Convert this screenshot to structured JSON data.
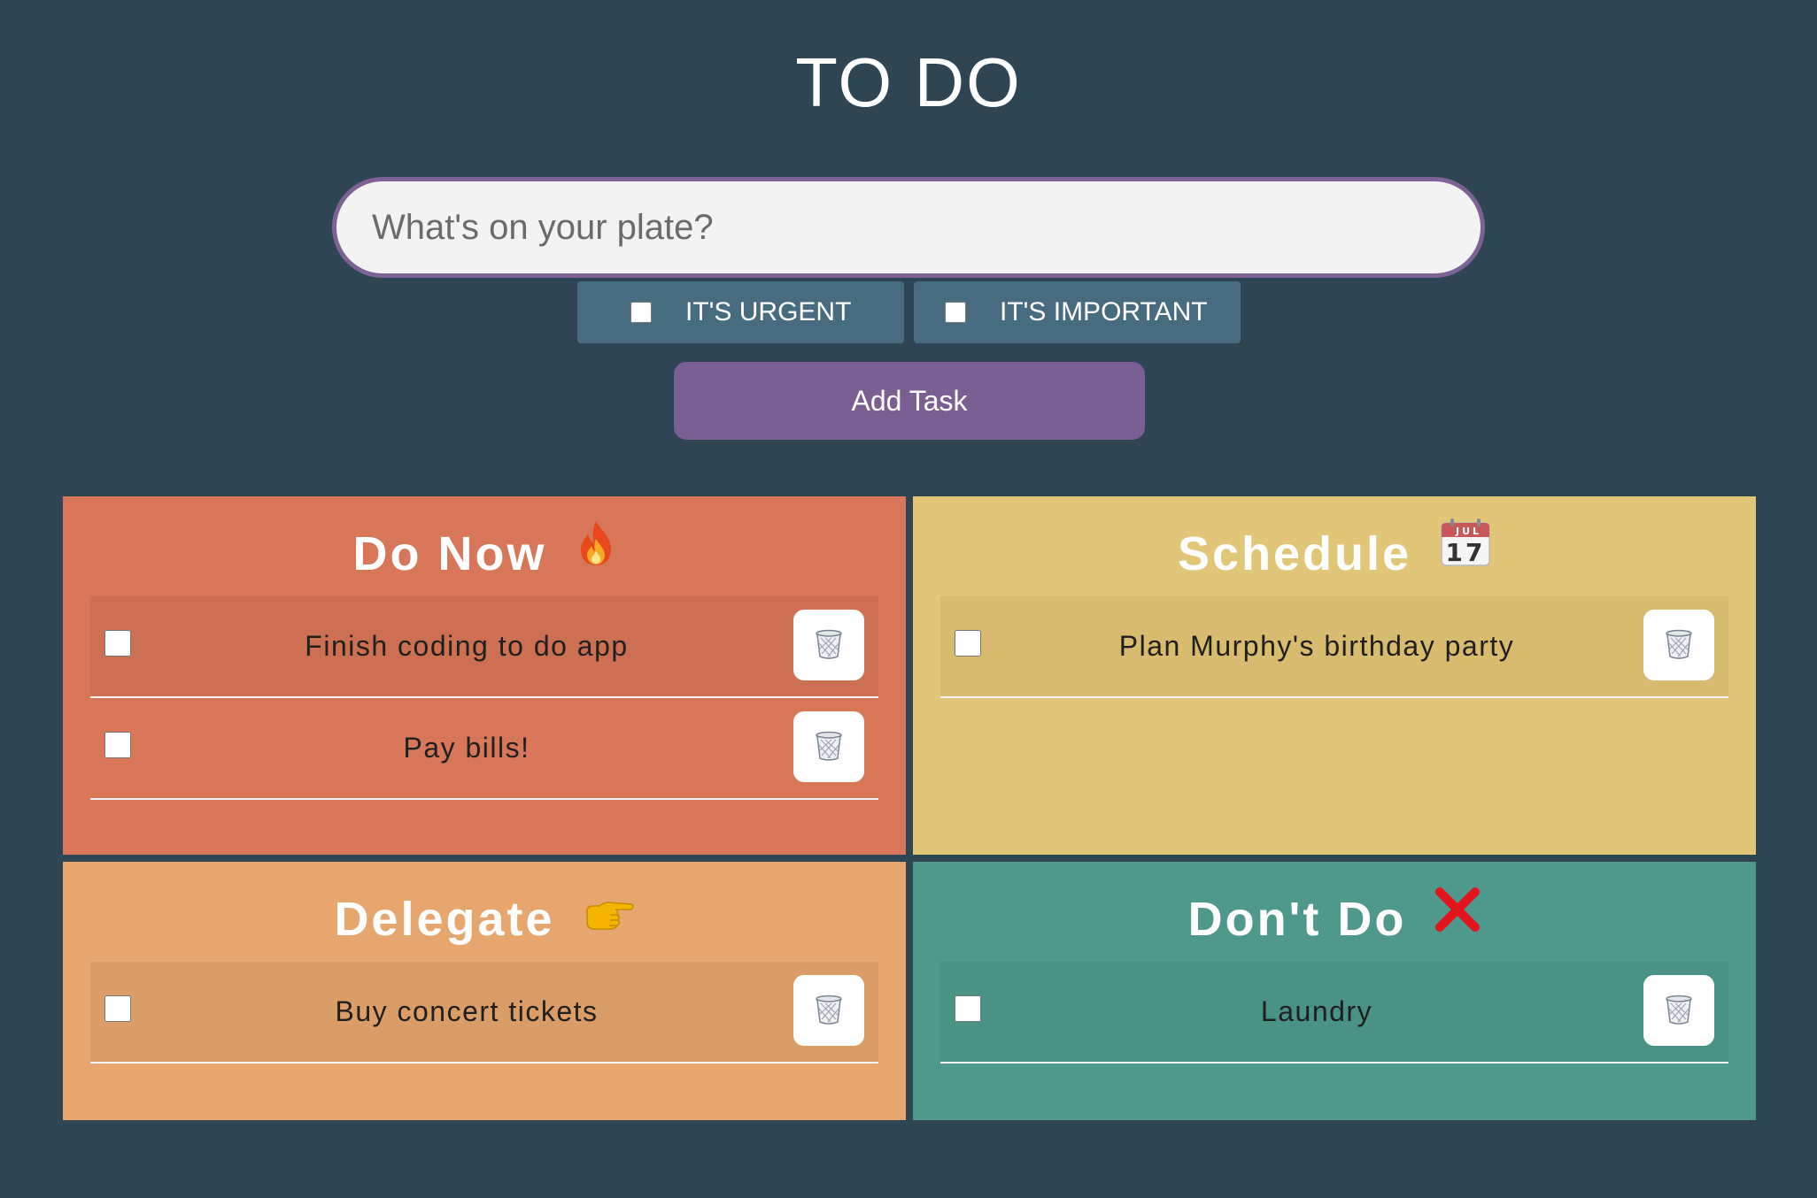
{
  "app": {
    "title": "TO DO"
  },
  "input": {
    "placeholder": "What's on your plate?",
    "value": ""
  },
  "flags": {
    "urgent_label": "IT'S URGENT",
    "urgent_checked": false,
    "important_label": "IT'S IMPORTANT",
    "important_checked": false
  },
  "add_button": {
    "label": "Add Task"
  },
  "icons": {
    "trash": "trash-icon",
    "fire": "fire-icon",
    "calendar": "calendar-icon",
    "pointing": "pointing-hand-icon",
    "cross": "cross-mark-icon"
  },
  "quadrants": [
    {
      "title": "Do Now",
      "color": "#d77658",
      "tasks": [
        {
          "text": "Finish coding to do app",
          "done": false
        },
        {
          "text": "Pay bills!",
          "done": false
        }
      ]
    },
    {
      "title": "Schedule",
      "color": "#e2c677",
      "calendar": {
        "month": "JUL",
        "day": "17"
      },
      "tasks": [
        {
          "text": "Plan Murphy's birthday party",
          "done": false
        }
      ]
    },
    {
      "title": "Delegate",
      "color": "#e7a66e",
      "tasks": [
        {
          "text": "Buy concert tickets",
          "done": false
        }
      ]
    },
    {
      "title": "Don't Do",
      "color": "#4e998c",
      "tasks": [
        {
          "text": "Laundry",
          "done": false
        }
      ]
    }
  ],
  "colors": {
    "background": "#2e4653",
    "accent": "#7b5e92",
    "flag_bg": "#486c7f"
  }
}
